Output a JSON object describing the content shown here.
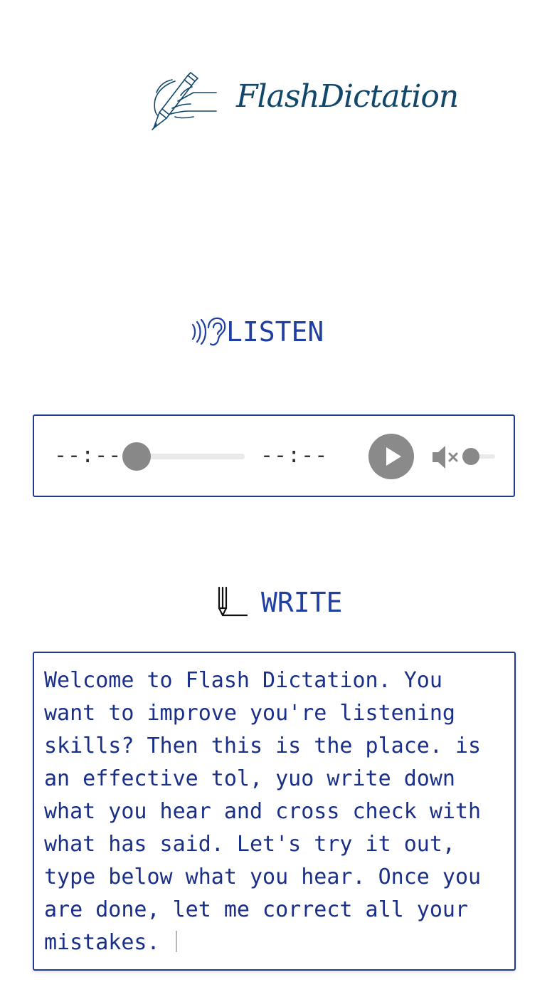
{
  "app": {
    "logo_text": "FlashDictation",
    "brand_color": "#10476b",
    "accent_color": "#1f3fa3"
  },
  "listen": {
    "heading": "LISTEN",
    "icon": "ear-icon"
  },
  "player": {
    "current_time": "--:--",
    "total_time": "--:--",
    "progress": 0,
    "muted": true,
    "volume": 0,
    "play_icon": "play-icon",
    "mute_icon": "volume-muted-icon"
  },
  "write": {
    "heading": "WRITE",
    "icon": "pencil-icon",
    "text": "Welcome to Flash Dictation. You want to improve you're listening skills? Then this is the place. is an effective tol, yuo write down what you hear and cross check with what has said. Let's try it out, type below what you hear. Once you are done, let me correct all your mistakes. "
  }
}
